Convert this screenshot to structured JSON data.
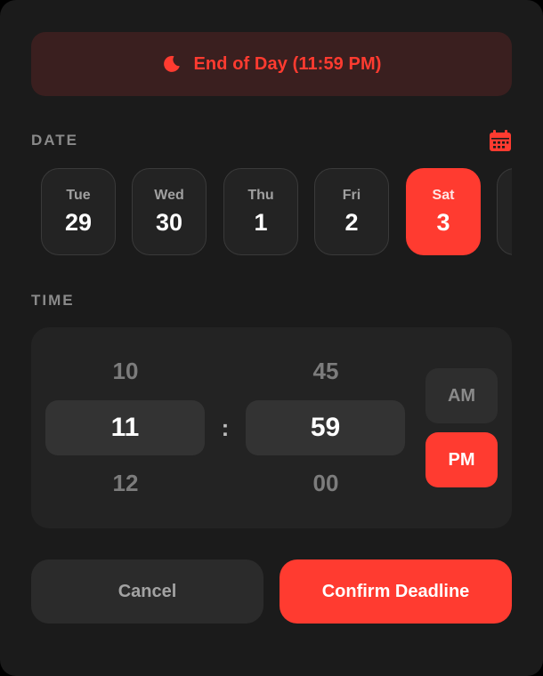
{
  "banner": {
    "text": "End of Day (11:59 PM)",
    "icon": "moon-icon"
  },
  "date_section": {
    "label": "DATE",
    "calendar_icon": "calendar-icon",
    "days": [
      {
        "dow": "Tue",
        "day": "29",
        "selected": false
      },
      {
        "dow": "Wed",
        "day": "30",
        "selected": false
      },
      {
        "dow": "Thu",
        "day": "1",
        "selected": false
      },
      {
        "dow": "Fri",
        "day": "2",
        "selected": false
      },
      {
        "dow": "Sat",
        "day": "3",
        "selected": true
      },
      {
        "dow": "",
        "day": "",
        "selected": false
      }
    ]
  },
  "time_section": {
    "label": "TIME",
    "hour": {
      "prev": "10",
      "current": "11",
      "next": "12"
    },
    "separator": ":",
    "minute": {
      "prev": "45",
      "current": "59",
      "next": "00"
    },
    "am_label": "AM",
    "pm_label": "PM",
    "selected_period": "PM"
  },
  "actions": {
    "cancel_label": "Cancel",
    "confirm_label": "Confirm Deadline"
  },
  "colors": {
    "accent": "#ff3b30",
    "background": "#1b1b1b",
    "card": "#232323"
  }
}
